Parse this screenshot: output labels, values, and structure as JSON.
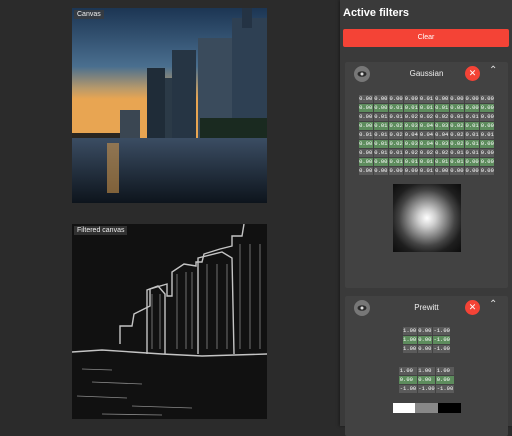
{
  "canvas": {
    "original_label": "Canvas",
    "filtered_label": "Filtered canvas"
  },
  "sidebar": {
    "title": "Active filters",
    "clear_label": "Clear",
    "filters": [
      {
        "name": "Gaussian",
        "kernel": [
          [
            "0.00",
            "0.00",
            "0.00",
            "0.00",
            "0.01",
            "0.00",
            "0.00",
            "0.00",
            "0.00"
          ],
          [
            "0.00",
            "0.00",
            "0.01",
            "0.01",
            "0.01",
            "0.01",
            "0.01",
            "0.00",
            "0.00"
          ],
          [
            "0.00",
            "0.01",
            "0.01",
            "0.02",
            "0.02",
            "0.02",
            "0.01",
            "0.01",
            "0.00"
          ],
          [
            "0.00",
            "0.01",
            "0.02",
            "0.03",
            "0.04",
            "0.03",
            "0.02",
            "0.01",
            "0.00"
          ],
          [
            "0.01",
            "0.01",
            "0.02",
            "0.04",
            "0.04",
            "0.04",
            "0.02",
            "0.01",
            "0.01"
          ],
          [
            "0.00",
            "0.01",
            "0.02",
            "0.03",
            "0.04",
            "0.03",
            "0.02",
            "0.01",
            "0.00"
          ],
          [
            "0.00",
            "0.01",
            "0.01",
            "0.02",
            "0.02",
            "0.02",
            "0.01",
            "0.01",
            "0.00"
          ],
          [
            "0.00",
            "0.00",
            "0.01",
            "0.01",
            "0.01",
            "0.01",
            "0.01",
            "0.00",
            "0.00"
          ],
          [
            "0.00",
            "0.00",
            "0.00",
            "0.00",
            "0.01",
            "0.00",
            "0.00",
            "0.00",
            "0.00"
          ]
        ]
      },
      {
        "name": "Prewitt",
        "kernel_x": [
          [
            "1.00",
            "0.00",
            "-1.00"
          ],
          [
            "1.00",
            "0.00",
            "-1.00"
          ],
          [
            "1.00",
            "0.00",
            "-1.00"
          ]
        ],
        "kernel_y": [
          [
            "1.00",
            "1.00",
            "1.00"
          ],
          [
            "0.00",
            "0.00",
            "0.00"
          ],
          [
            "-1.00",
            "-1.00",
            "-1.00"
          ]
        ]
      }
    ]
  }
}
